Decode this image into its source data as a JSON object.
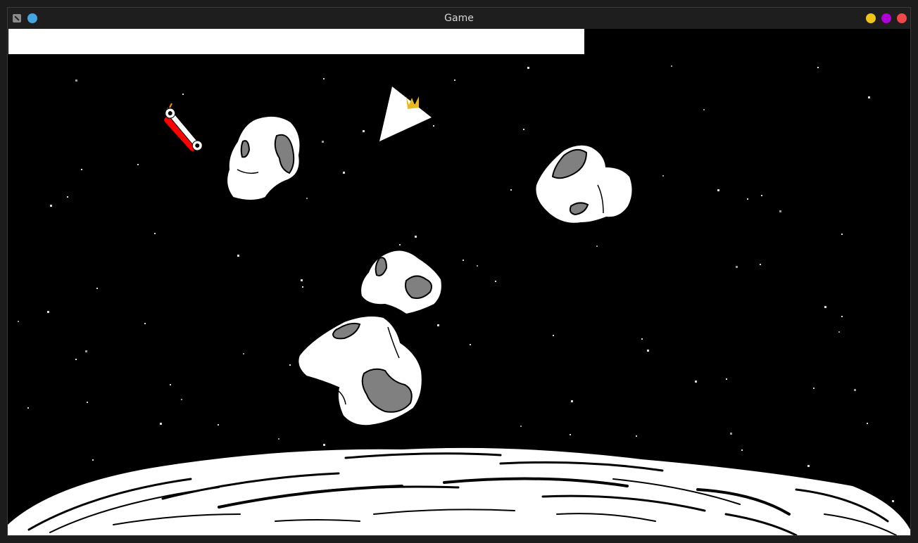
{
  "window": {
    "title": "Game",
    "controls": [
      {
        "name": "minimize-button",
        "color": "#f0c419"
      },
      {
        "name": "maximize-button",
        "color": "#b000d8"
      },
      {
        "name": "close-button",
        "color": "#f04848"
      }
    ],
    "sticky_color": "#45a5e0"
  },
  "game": {
    "background": "#000000",
    "hud_bar_color": "#ffffff",
    "ship_color": "#ffffff",
    "crown_color": "#e8b820",
    "powerup_color": "#ff0000",
    "asteroid_fill": "#ffffff",
    "asteroid_crater": "#808080",
    "asteroid_count": 4,
    "powerup_icon": "wrench-dynamite-icon"
  }
}
